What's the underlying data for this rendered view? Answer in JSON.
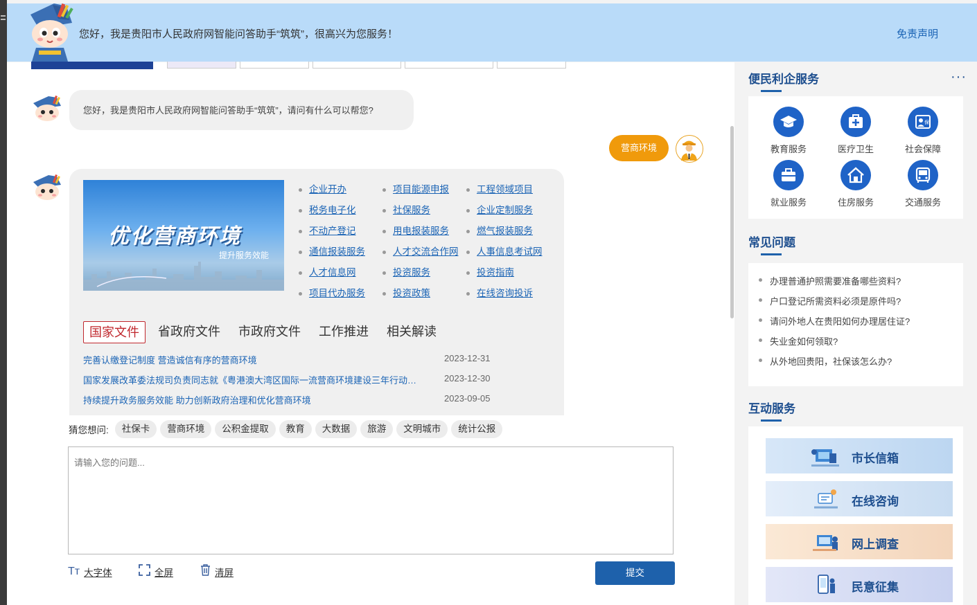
{
  "banner": {
    "greeting": "您好，我是贵阳市人民政府网智能问答助手“筑筑”，很高兴为您服务！",
    "disclaimer": "免责声明"
  },
  "chat": {
    "bot_greeting": "您好，我是贵阳市人民政府网智能问答助手“筑筑”，请问有什么可以帮您?",
    "user_message": "营商环境",
    "promo": {
      "title": "优化营商环境",
      "subtitle": "提升服务效能"
    },
    "links": [
      [
        "企业开办",
        "项目能源申报",
        "工程领域项目"
      ],
      [
        "税务电子化",
        "社保服务",
        "企业定制服务"
      ],
      [
        "不动产登记",
        "用电报装服务",
        "燃气报装服务"
      ],
      [
        "通信报装服务",
        "人才交流合作网",
        "人事信息考试网"
      ],
      [
        "人才信息网",
        "投资服务",
        "投资指南"
      ],
      [
        "项目代办服务",
        "投资政策",
        "在线咨询投诉"
      ]
    ],
    "tabs": [
      "国家文件",
      "省政府文件",
      "市政府文件",
      "工作推进",
      "相关解读"
    ],
    "active_tab": 0,
    "news": [
      {
        "title": "完善认缴登记制度 营造诚信有序的营商环境",
        "date": "2023-12-31"
      },
      {
        "title": "国家发展改革委法规司负责同志就《粤港澳大湾区国际一流营商环境建设三年行动计划》答记者问",
        "date": "2023-12-30"
      },
      {
        "title": "持续提升政务服务效能 助力创新政府治理和优化营商环境",
        "date": "2023-09-05"
      }
    ]
  },
  "guess": {
    "label": "猜您想问:",
    "chips": [
      "社保卡",
      "营商环境",
      "公积金提取",
      "教育",
      "大数据",
      "旅游",
      "文明城市",
      "统计公报"
    ]
  },
  "input": {
    "placeholder": "请输入您的问题..."
  },
  "toolbar": {
    "font_label": "大字体",
    "font_icon": "Tт",
    "fullscreen_label": "全屏",
    "clear_label": "清屏",
    "submit_label": "提交"
  },
  "right": {
    "services_title": "便民利企服务",
    "more": "···",
    "services": [
      {
        "label": "教育服务",
        "icon": "graduation-cap-icon"
      },
      {
        "label": "医疗卫生",
        "icon": "medical-kit-icon"
      },
      {
        "label": "社会保障",
        "icon": "insurance-card-icon"
      },
      {
        "label": "就业服务",
        "icon": "briefcase-icon"
      },
      {
        "label": "住房服务",
        "icon": "house-icon"
      },
      {
        "label": "交通服务",
        "icon": "bus-icon"
      }
    ],
    "faq_title": "常见问题",
    "faqs": [
      "办理普通护照需要准备哪些资料?",
      "户口登记所需资料必须是原件吗?",
      "请问外地人在贵阳如何办理居住证?",
      "失业金如何领取?",
      "从外地回贵阳，社保该怎么办?"
    ],
    "interactive_title": "互动服务",
    "interactive": [
      {
        "label": "市长信箱",
        "bg": "#c4dcf4"
      },
      {
        "label": "在线咨询",
        "bg": "#d3e5f7"
      },
      {
        "label": "网上调查",
        "bg": "#f6dfc8"
      },
      {
        "label": "民意征集",
        "bg": "#d8ddf4"
      }
    ]
  },
  "colors": {
    "banner_bg": "#b9dbf9",
    "accent_blue": "#1e61ab",
    "user_tag": "#f09a0b",
    "active_tab": "#c0272d",
    "link": "#1b64b5"
  }
}
